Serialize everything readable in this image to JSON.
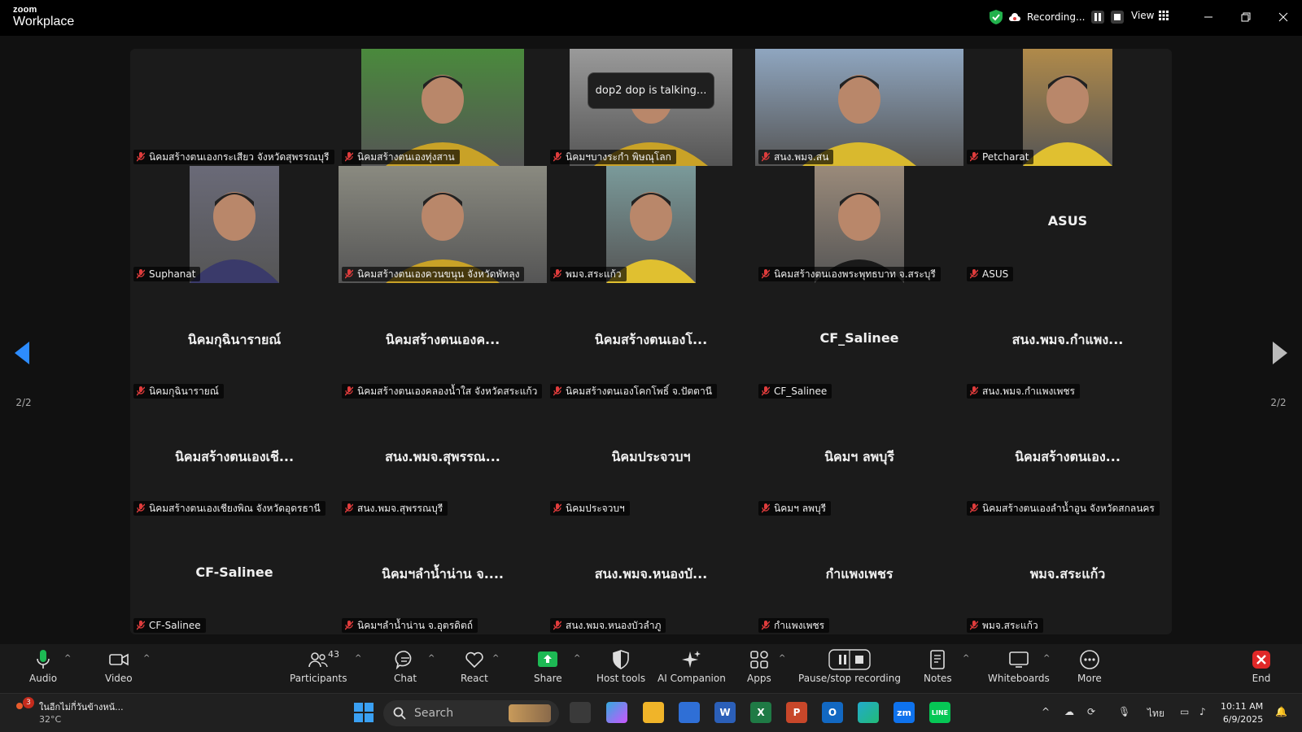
{
  "app": {
    "logo_top": "zoom",
    "logo_bottom": "Workplace"
  },
  "header": {
    "recording_label": "Recording...",
    "view_label": "View"
  },
  "toast": "dop2 dop is talking...",
  "pager": {
    "left": "2/2",
    "right": "2/2"
  },
  "tiles": [
    {
      "name": "นิคมสร้างตนเองกระเสียว จังหวัดสุพรรณบุรี",
      "big": "",
      "video": false
    },
    {
      "name": "นิคมสร้างตนเองทุ่งสาน",
      "big": "",
      "video": true,
      "bg": "#4a8a3c",
      "shirt": "#c9a227"
    },
    {
      "name": "นิคมฯบางระกำ พิษณุโลก",
      "big": "",
      "video": true,
      "bg": "#9a9a9a",
      "shirt": "#c9a227"
    },
    {
      "name": "สนง.พมจ.สน",
      "big": "",
      "video": true,
      "bg": "#8fa6c0",
      "shirt": "#d9b92e"
    },
    {
      "name": "Petcharat",
      "big": "",
      "video": true,
      "bg": "#b08a4a",
      "shirt": "#e0c030"
    },
    {
      "name": "Suphanat",
      "big": "",
      "video": true,
      "bg": "#6a6a78",
      "shirt": "#3a3a6a"
    },
    {
      "name": "นิคมสร้างตนเองควนขนุน จังหวัดพัทลุง",
      "big": "",
      "video": true,
      "bg": "#8a8a80",
      "shirt": "#c9a227"
    },
    {
      "name": "พมจ.สระแก้ว",
      "big": "",
      "video": true,
      "bg": "#7a9a9a",
      "shirt": "#e0c030"
    },
    {
      "name": "นิคมสร้างตนเองพระพุทธบาท จ.สระบุรี",
      "big": "",
      "video": true,
      "bg": "#9a8a7a",
      "shirt": "#1a1a1a"
    },
    {
      "name": "ASUS",
      "big": "ASUS",
      "video": false
    },
    {
      "name": "นิคมกุฉินารายณ์",
      "big": "นิคมกุฉินารายณ์",
      "video": false
    },
    {
      "name": "นิคมสร้างตนเองคลองน้ำใส จังหวัดสระแก้ว",
      "big": "นิคมสร้างตนเองค...",
      "video": false
    },
    {
      "name": "นิคมสร้างตนเองโคกโพธิ์ จ.ปัตตานี",
      "big": "นิคมสร้างตนเองโ...",
      "video": false
    },
    {
      "name": "CF_Salinee",
      "big": "CF_Salinee",
      "video": false
    },
    {
      "name": "สนง.พมจ.กำแพงเพชร",
      "big": "สนง.พมจ.กำแพง...",
      "video": false
    },
    {
      "name": "นิคมสร้างตนเองเชียงพิณ จังหวัดอุดรธานี",
      "big": "นิคมสร้างตนเองเชี...",
      "video": false
    },
    {
      "name": "สนง.พมจ.สุพรรณบุรี",
      "big": "สนง.พมจ.สุพรรณ...",
      "video": false
    },
    {
      "name": "นิคมประจวบฯ",
      "big": "นิคมประจวบฯ",
      "video": false
    },
    {
      "name": "นิคมฯ ลพบุรี",
      "big": "นิคมฯ ลพบุรี",
      "video": false
    },
    {
      "name": "นิคมสร้างตนเองลำน้ำอูน จังหวัดสกลนคร",
      "big": "นิคมสร้างตนเอง...",
      "video": false
    },
    {
      "name": "CF-Salinee",
      "big": "CF-Salinee",
      "video": false
    },
    {
      "name": "นิคมฯลำน้ำน่าน จ.อุตรดิตถ์",
      "big": "นิคมฯลำน้ำน่าน จ....",
      "video": false
    },
    {
      "name": "สนง.พมจ.หนองบัวลำภู",
      "big": "สนง.พมจ.หนองบั...",
      "video": false
    },
    {
      "name": "กำแพงเพชร",
      "big": "กำแพงเพชร",
      "video": false
    },
    {
      "name": "พมจ.สระแก้ว",
      "big": "พมจ.สระแก้ว",
      "video": false
    }
  ],
  "toolbar": {
    "audio": "Audio",
    "video": "Video",
    "participants": "Participants",
    "participants_count": "43",
    "chat": "Chat",
    "react": "React",
    "share": "Share",
    "host_tools": "Host tools",
    "ai": "AI Companion",
    "apps": "Apps",
    "recording": "Pause/stop recording",
    "notes": "Notes",
    "whiteboards": "Whiteboards",
    "more": "More",
    "end": "End"
  },
  "taskbar": {
    "weather_badge": "3",
    "weather_text": "ในอีกไม่กี่วันข้างหน้...",
    "temperature": "32°C",
    "search": "Search",
    "lang": "ไทย",
    "time": "10:11 AM",
    "date": "6/9/2025"
  },
  "colors": {
    "accent": "#0e72ed",
    "share_green": "#1db954",
    "end_red": "#e02828",
    "muted_red": "#e03c3c"
  }
}
